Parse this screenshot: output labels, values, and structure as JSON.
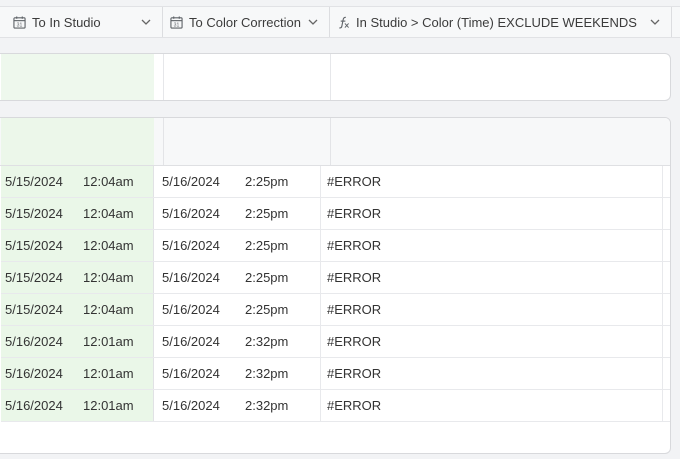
{
  "columns": {
    "in_studio": {
      "label": "To In Studio",
      "icon": "calendar-icon"
    },
    "color_correction": {
      "label": "To Color Correction",
      "icon": "calendar-icon"
    },
    "formula": {
      "label": "In Studio > Color (Time) EXCLUDE WEEKENDS",
      "icon": "formula-icon"
    }
  },
  "colors": {
    "date_column_tint": "#eaf7e8",
    "background": "#f2f3f5"
  },
  "rows": [
    {
      "in_date": "5/15/2024",
      "in_time": "12:04am",
      "cc_date": "5/16/2024",
      "cc_time": "2:25pm",
      "formula": "#ERROR"
    },
    {
      "in_date": "5/15/2024",
      "in_time": "12:04am",
      "cc_date": "5/16/2024",
      "cc_time": "2:25pm",
      "formula": "#ERROR"
    },
    {
      "in_date": "5/15/2024",
      "in_time": "12:04am",
      "cc_date": "5/16/2024",
      "cc_time": "2:25pm",
      "formula": "#ERROR"
    },
    {
      "in_date": "5/15/2024",
      "in_time": "12:04am",
      "cc_date": "5/16/2024",
      "cc_time": "2:25pm",
      "formula": "#ERROR"
    },
    {
      "in_date": "5/15/2024",
      "in_time": "12:04am",
      "cc_date": "5/16/2024",
      "cc_time": "2:25pm",
      "formula": "#ERROR"
    },
    {
      "in_date": "5/16/2024",
      "in_time": "12:01am",
      "cc_date": "5/16/2024",
      "cc_time": "2:32pm",
      "formula": "#ERROR"
    },
    {
      "in_date": "5/16/2024",
      "in_time": "12:01am",
      "cc_date": "5/16/2024",
      "cc_time": "2:32pm",
      "formula": "#ERROR"
    },
    {
      "in_date": "5/16/2024",
      "in_time": "12:01am",
      "cc_date": "5/16/2024",
      "cc_time": "2:32pm",
      "formula": "#ERROR"
    }
  ]
}
